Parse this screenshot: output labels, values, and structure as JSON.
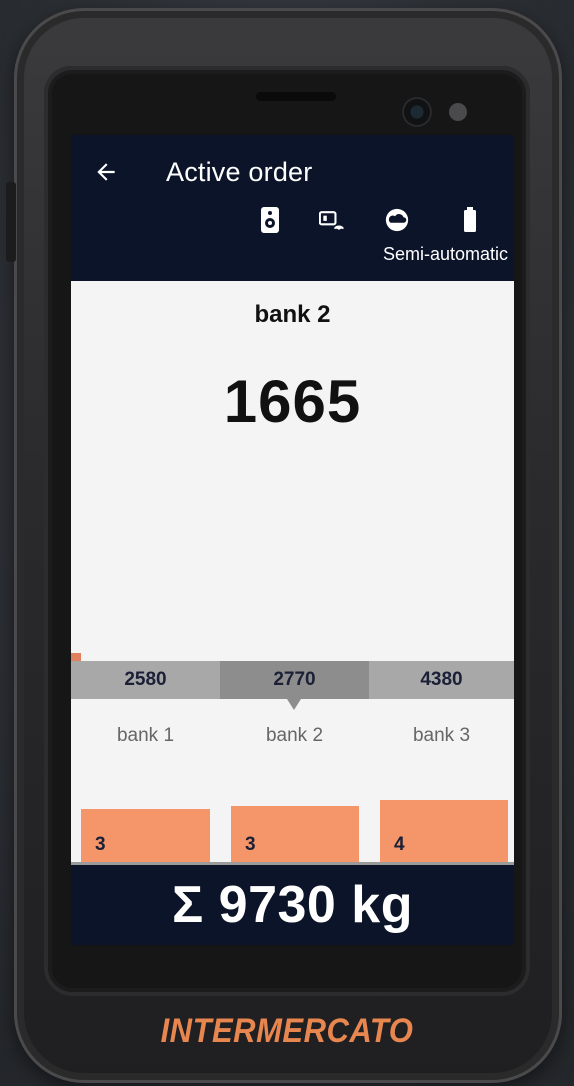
{
  "header": {
    "title": "Active order",
    "mode_label": "Semi-automatic",
    "status_icons": [
      "speaker-icon",
      "card-reader-icon",
      "cloud-icon",
      "battery-icon"
    ]
  },
  "current": {
    "bank_name": "bank 2",
    "weight": "1665"
  },
  "banks": [
    {
      "label": "bank 1",
      "weight": "2580",
      "count": "3",
      "fill": 0.85,
      "active": false
    },
    {
      "label": "bank 2",
      "weight": "2770",
      "count": "3",
      "fill": 0.9,
      "active": true
    },
    {
      "label": "bank 3",
      "weight": "4380",
      "count": "4",
      "fill": 1.0,
      "active": false
    }
  ],
  "total": {
    "text": "Σ 9730 kg"
  },
  "brand": {
    "name": "INTERMERCATO"
  },
  "colors": {
    "appbar": "#0b1428",
    "bar_fill": "#f4956a",
    "tab_bg": "#a8a8a8",
    "tab_active_bg": "#8d8d8d",
    "brand": "#e8864f"
  }
}
